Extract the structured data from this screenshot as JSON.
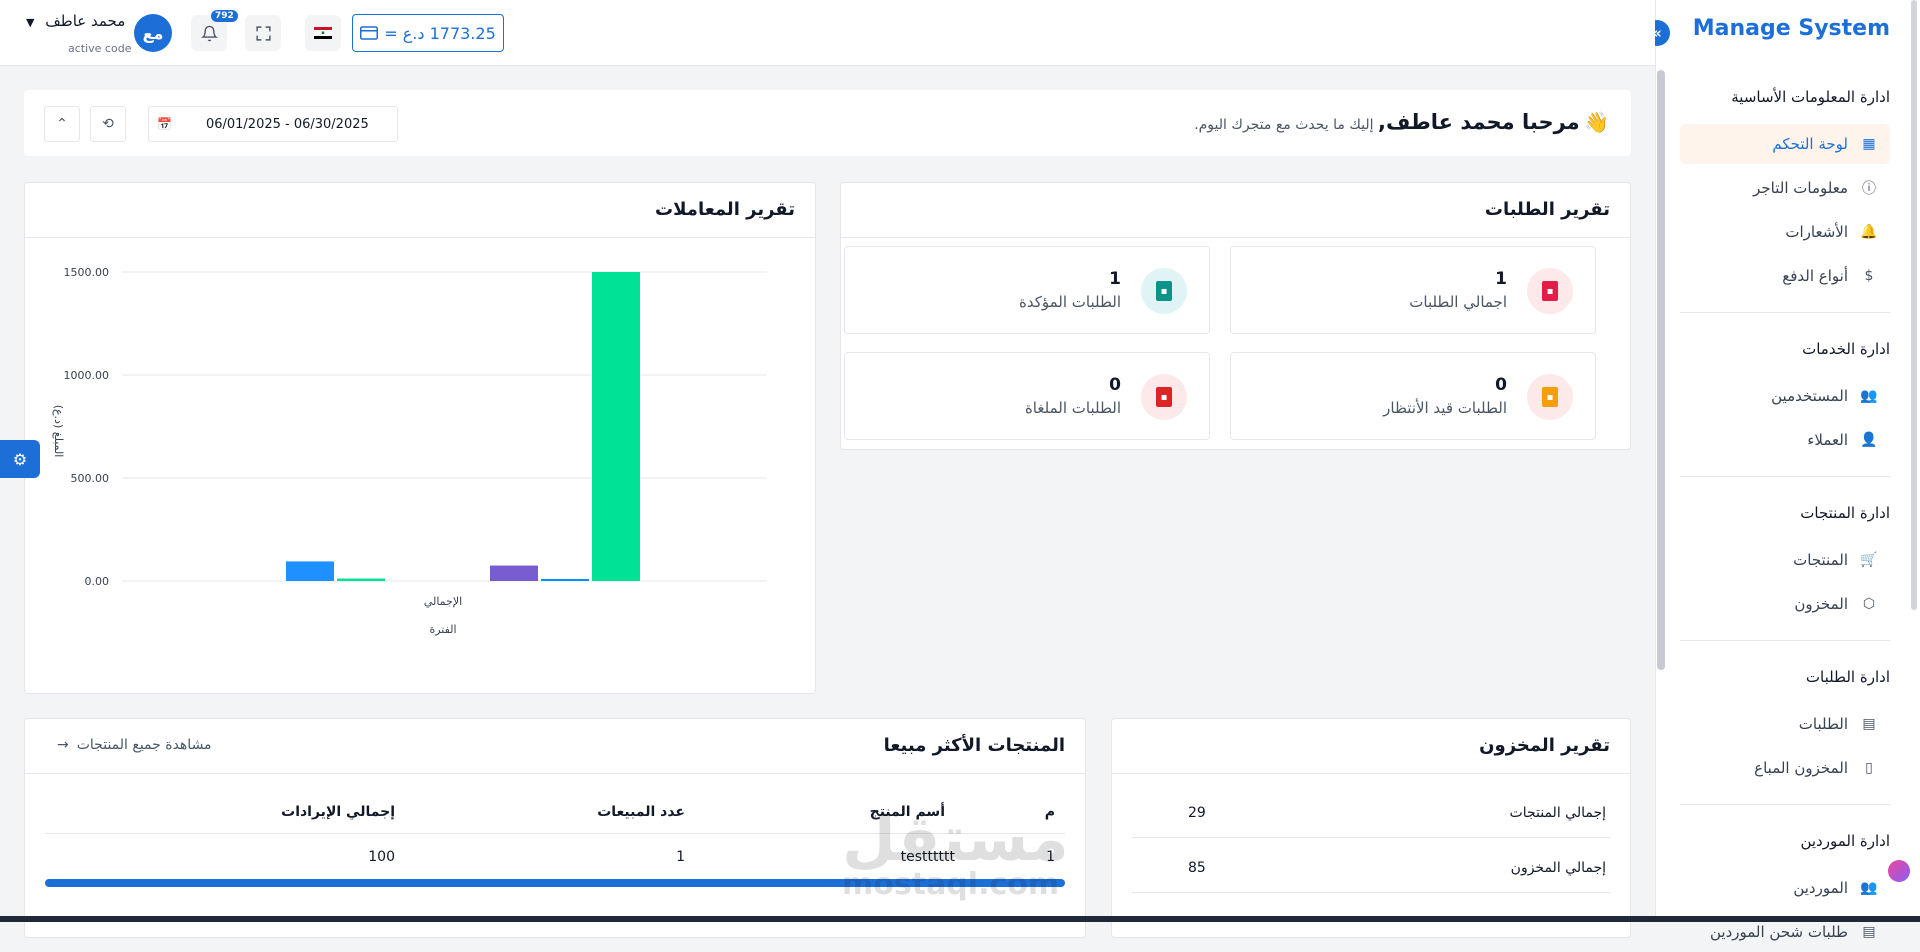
{
  "sidebar": {
    "brand": "Manage System",
    "collapse_icon": "«",
    "sections": [
      {
        "title": "ادارة المعلومات الأساسية",
        "items": [
          {
            "label": "لوحة التحكم",
            "icon": "▦",
            "active": true
          },
          {
            "label": "معلومات التاجر",
            "icon": "ⓘ"
          },
          {
            "label": "الأشعارات",
            "icon": "🔔"
          },
          {
            "label": "أنواع الدفع",
            "icon": "$"
          }
        ]
      },
      {
        "title": "ادارة الخدمات",
        "items": [
          {
            "label": "المستخدمين",
            "icon": "👥"
          },
          {
            "label": "العملاء",
            "icon": "👤"
          }
        ]
      },
      {
        "title": "ادارة المنتجات",
        "items": [
          {
            "label": "المنتجات",
            "icon": "🛒"
          },
          {
            "label": "المخزون",
            "icon": "⬡"
          }
        ]
      },
      {
        "title": "ادارة الطلبات",
        "items": [
          {
            "label": "الطلبات",
            "icon": "▤"
          },
          {
            "label": "المخزون المباع",
            "icon": "▯"
          }
        ]
      },
      {
        "title": "ادارة الموردين",
        "items": [
          {
            "label": "الموردين",
            "icon": "👥"
          },
          {
            "label": "طلبات شحن الموردين",
            "icon": "▤"
          }
        ]
      }
    ]
  },
  "header": {
    "user_name": "محمد عاطف",
    "user_sub": "active code",
    "avatar_initials": "مع",
    "notification_count": "792",
    "balance": "1773.25 د.ع =",
    "colors": {
      "accent": "#1d6fd8"
    }
  },
  "welcome": {
    "greeting": "مرحبا محمد عاطف,",
    "subtitle": "إليك ما يحدث مع متجرك اليوم.",
    "date_range": "06/01/2025 - 06/30/2025"
  },
  "orders_report": {
    "title": "تقرير الطلبات",
    "stats": [
      {
        "value": "1",
        "label": "اجمالي الطلبات",
        "color": "#e11d48",
        "bg": "#fde8ea"
      },
      {
        "value": "1",
        "label": "الطلبات المؤكدة",
        "color": "#0d9488",
        "bg": "#e0f4f5"
      },
      {
        "value": "0",
        "label": "الطلبات قيد الأنتظار",
        "color": "#f59e0b",
        "bg": "#fde8ea"
      },
      {
        "value": "0",
        "label": "الطلبات الملغاة",
        "color": "#dc2626",
        "bg": "#fde8ea"
      }
    ]
  },
  "transactions_report": {
    "title": "تقرير المعاملات"
  },
  "chart_data": {
    "type": "bar",
    "title": "",
    "xlabel": "الفترة",
    "ylabel": "المبلغ (د.ع)",
    "categories": [
      "الإجمالي"
    ],
    "ylim": [
      0,
      1500
    ],
    "yticks": [
      "0.00",
      "500.00",
      "1000.00",
      "1500.00"
    ],
    "series": [
      {
        "values": [
          95
        ],
        "color": "#1e90ff"
      },
      {
        "values": [
          12
        ],
        "color": "#00e396"
      },
      {
        "values": [
          0
        ],
        "color": "#feb019"
      },
      {
        "values": [
          0
        ],
        "color": "#ff4560"
      },
      {
        "values": [
          75
        ],
        "color": "#775dd0"
      },
      {
        "values": [
          8
        ],
        "color": "#008ffb"
      },
      {
        "values": [
          1500
        ],
        "color": "#00e396"
      }
    ],
    "grid": true
  },
  "inventory_report": {
    "title": "تقرير المخزون",
    "rows": [
      {
        "label": "إجمالي المنتجات",
        "value": "29"
      },
      {
        "label": "إجمالي المخزون",
        "value": "85"
      }
    ]
  },
  "top_products": {
    "title": "المنتجات الأكثر مبيعا",
    "view_all": "مشاهدة جميع المنتجات",
    "headers": {
      "index": "م",
      "name": "أسم المنتج",
      "sales": "عدد المبيعات",
      "revenue": "إجمالي الإيرادات"
    },
    "rows": [
      {
        "index": "1",
        "name": "testttttt",
        "sales": "1",
        "revenue": "100",
        "progress": 1.0
      }
    ]
  },
  "watermark": {
    "ar": "مستقل",
    "en": "mostaql.com"
  }
}
